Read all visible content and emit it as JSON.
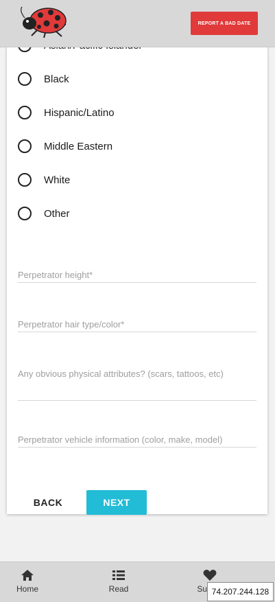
{
  "header": {
    "report_button_label": "REPORT A BAD DATE",
    "logo_icon": "ladybug-icon"
  },
  "form": {
    "ethnicity_options": [
      {
        "label": "Asian/Pacific Islander"
      },
      {
        "label": "Black"
      },
      {
        "label": "Hispanic/Latino"
      },
      {
        "label": "Middle Eastern"
      },
      {
        "label": "White"
      },
      {
        "label": "Other"
      }
    ],
    "fields": {
      "height_placeholder": "Perpetrator height*",
      "hair_placeholder": "Perpetrator hair type/color*",
      "attributes_placeholder": "Any obvious physical attributes? (scars, tattoos, etc)",
      "vehicle_placeholder": "Perpetrator vehicle information (color, make, model)"
    },
    "back_label": "BACK",
    "next_label": "NEXT"
  },
  "bottom_nav": {
    "items": [
      {
        "label": "Home",
        "icon": "home-icon"
      },
      {
        "label": "Read",
        "icon": "list-icon"
      },
      {
        "label": "Submit",
        "icon": "heart-icon"
      }
    ]
  },
  "tooltip": {
    "ip": "74.207.244.128"
  },
  "colors": {
    "accent_red": "#e03a3a",
    "accent_cyan": "#22bcd6",
    "header_bg": "#d9d8d8"
  }
}
